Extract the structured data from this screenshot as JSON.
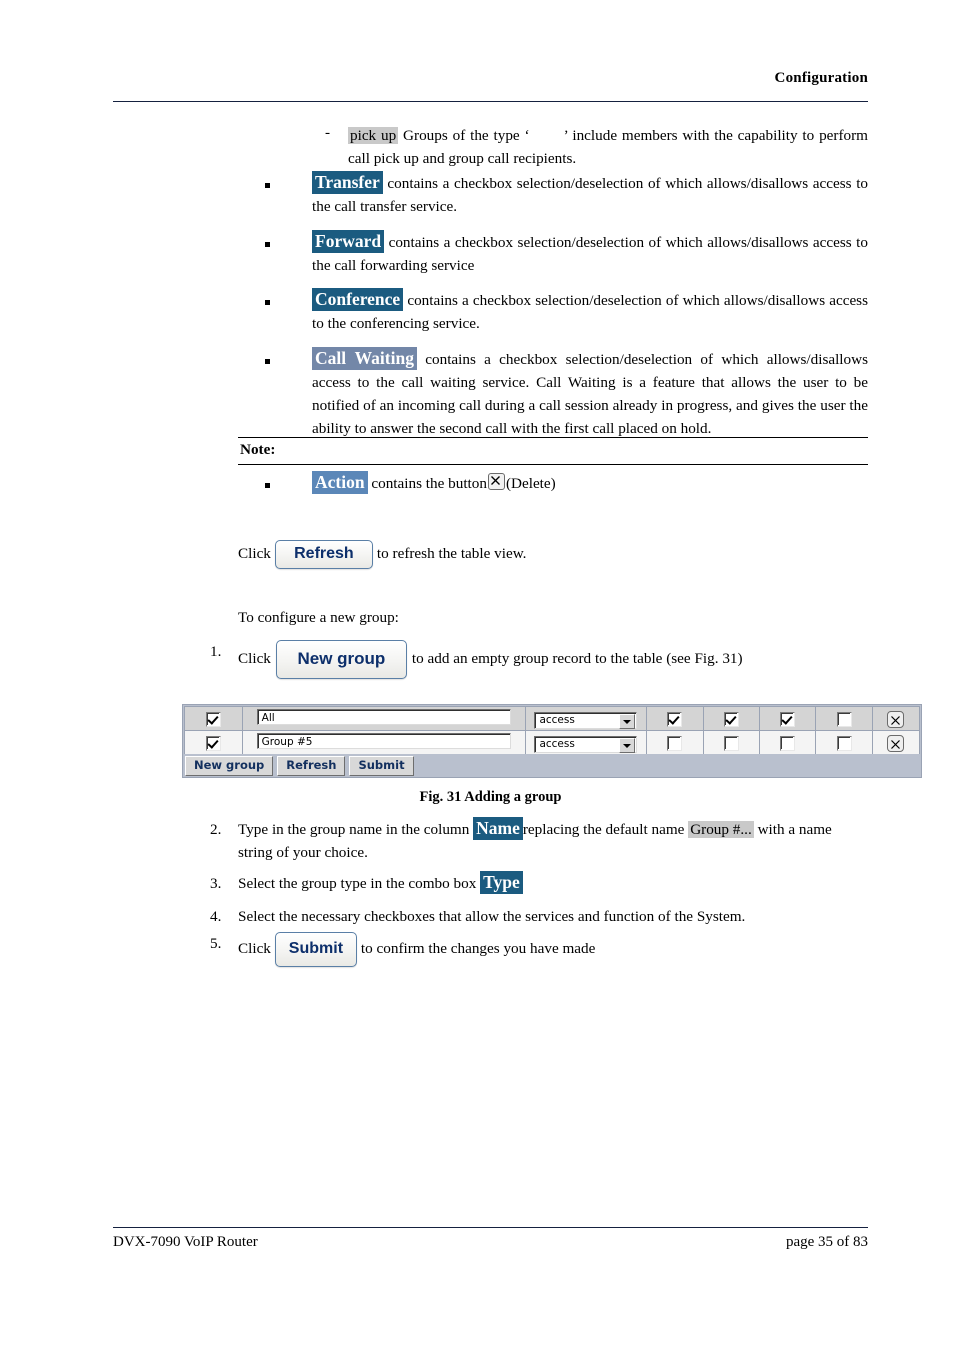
{
  "header": {
    "title": "Configuration"
  },
  "dash_item": {
    "marker": "-",
    "highlight": "pick up",
    "text_before_quote": "Groups of the type ‘",
    "text_after_quote": "’ include members with the capability to perform call pick up and group call recipients."
  },
  "bullets": [
    {
      "term": "Transfer",
      "text": "contains a checkbox selection/deselection of which allows/disallows access to the call transfer service."
    },
    {
      "term": "Forward",
      "text": "contains a checkbox selection/deselection of which allows/disallows access to the call forwarding service"
    },
    {
      "term": "Conference",
      "text": "contains a checkbox selection/deselection of which allows/disallows access to the conferencing service."
    },
    {
      "term": "Call Waiting",
      "text": "contains a checkbox selection/deselection of which allows/disallows access to the call waiting service. Call Waiting is a feature that allows the user to be notified of an incoming call during a call session already in progress, and gives the user the ability to answer the second call with the first call placed on hold."
    }
  ],
  "note": {
    "label": "Note:",
    "term": "Action",
    "text_before_icon": "contains the button",
    "icon": "delete-x-icon",
    "text_after_icon": "(Delete)"
  },
  "refresh_line": {
    "click_label": "Click",
    "button_label": "Refresh",
    "tail": "to refresh the table view."
  },
  "configure_intro": "To configure a new group:",
  "steps": [
    {
      "number": "1.",
      "click_label": "Click",
      "button_label": "New group",
      "tail": "to add an empty group record to the table (see Fig. 31)"
    },
    {
      "number": "2.",
      "text_before": "Type in the group name in the column",
      "term": "Name",
      "text_middle": "replacing the default name",
      "gray_term": "Group #...",
      "text_after": "with a name string of your choice."
    },
    {
      "number": "3.",
      "text_before": "Select the group type in the combo box",
      "term": "Type"
    },
    {
      "number": "4.",
      "text": "Select the necessary checkboxes that allow the services and function of the System."
    },
    {
      "number": "5.",
      "click_label": "Click",
      "button_label": "Submit",
      "tail": "to confirm the changes you have made"
    }
  ],
  "figure": {
    "caption": "Fig. 31 Adding a group",
    "rows": [
      {
        "enabled": true,
        "name": "All",
        "type": "access",
        "services": [
          true,
          true,
          true,
          false
        ],
        "action_icon": "delete-x-icon"
      },
      {
        "enabled": true,
        "name": "Group #5",
        "type": "access",
        "services": [
          false,
          false,
          false,
          false
        ],
        "action_icon": "delete-x-icon"
      }
    ],
    "toolbar": [
      "New group",
      "Refresh",
      "Submit"
    ]
  },
  "footer": {
    "left": "DVX-7090 VoIP Router",
    "right": "page 35 of 83"
  },
  "colors": {
    "highlight_teal": "#1b5b80",
    "highlight_steel": "#5b87b8",
    "highlight_slate": "#7387a8",
    "highlight_gray": "#c9c9c9",
    "button_text": "#0d2f6b",
    "rule": "#15213f",
    "figure_chrome": "#b9c0ce"
  }
}
